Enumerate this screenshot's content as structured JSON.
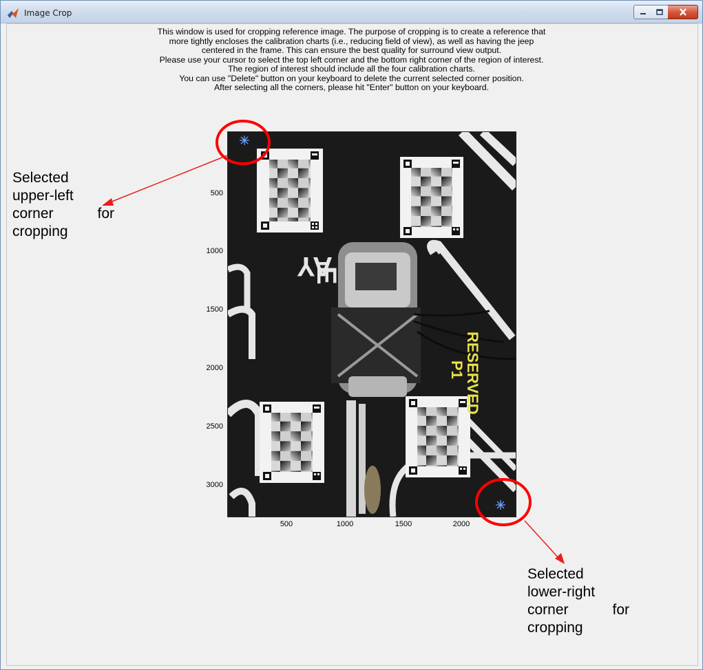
{
  "window": {
    "title": "Image Crop",
    "minimize_icon": "minimize-icon",
    "maximize_icon": "maximize-icon",
    "close_icon": "close-icon",
    "close_button_color": "#c8432a"
  },
  "instructions": [
    "This window is used for cropping reference image. The purpose of cropping is to create a reference that",
    "more tightly encloses the calibration charts (i.e., reducing field of view), as well as having the jeep",
    "centered in the frame. This can ensure the best quality for surround view output.",
    "Please use your cursor to select the top left corner and the bottom right corner of the region of interest.",
    "The region of interest should include all the four calibration charts.",
    "You can use \"Delete\" button on your keyboard to delete the current selected corner position.",
    "After selecting all the corners, please hit \"Enter\" button on your keyboard."
  ],
  "axes": {
    "yticks": [
      "500",
      "1000",
      "1500",
      "2000",
      "2500",
      "3000"
    ],
    "xticks": [
      "500",
      "1000",
      "1500",
      "2000"
    ]
  },
  "photo": {
    "vertical_text_1": "RESERVED",
    "vertical_text_2": "P1",
    "floor_text": "AY",
    "floor_text_2": "E",
    "text_color": "#e8e24a"
  },
  "annotations": {
    "upper_left": {
      "line1": "Selected",
      "line2": "upper-left",
      "line3a": "corner",
      "line3b": "for",
      "line4": "cropping"
    },
    "lower_right": {
      "line1": "Selected",
      "line2": "lower-right",
      "line3a": "corner",
      "line3b": "for",
      "line4": "cropping"
    },
    "highlight_color": "#ff0000",
    "marker_color": "#4f8cff"
  }
}
